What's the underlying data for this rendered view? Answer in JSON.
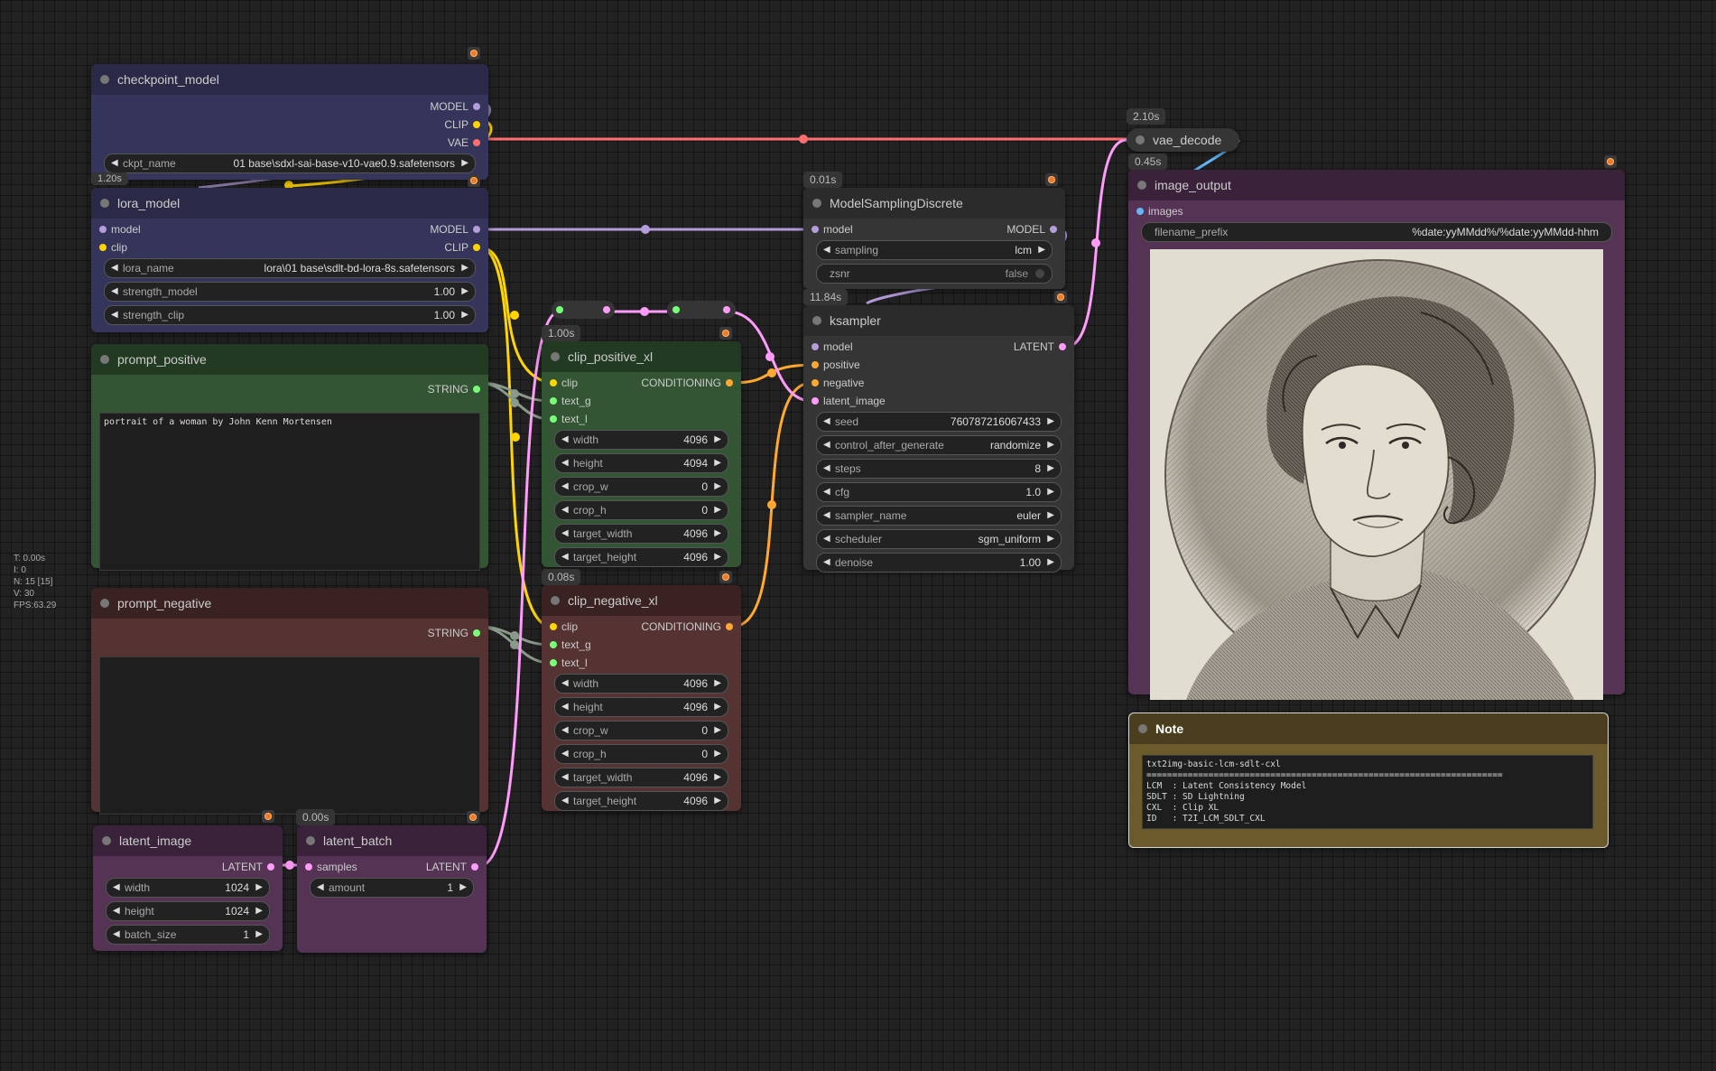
{
  "colors": {
    "model": "#b39ddb",
    "clip": "#ffd500",
    "vae": "#ff6e6e",
    "conditioning": "#ffa931",
    "latent": "#ff9cf9",
    "string": "#77ff77",
    "image": "#64b5f6",
    "reroute": "#aaaaaa"
  },
  "stats": {
    "t": "T: 0.00s",
    "i": "I: 0",
    "n": "N: 15 [15]",
    "v": "V: 30",
    "fps": "FPS:63.29"
  },
  "checkpoint_model": {
    "title": "checkpoint_model",
    "timer": "1.20s",
    "outputs": [
      "MODEL",
      "CLIP",
      "VAE"
    ],
    "ckpt_label": "ckpt_name",
    "ckpt_value": "01 base\\sdxl-sai-base-v10-vae0.9.safetensors"
  },
  "lora_model": {
    "title": "lora_model",
    "in_model": "model",
    "in_clip": "clip",
    "out_model": "MODEL",
    "out_clip": "CLIP",
    "widgets": [
      {
        "label": "lora_name",
        "value": "lora\\01 base\\sdlt-bd-lora-8s.safetensors"
      },
      {
        "label": "strength_model",
        "value": "1.00"
      },
      {
        "label": "strength_clip",
        "value": "1.00"
      }
    ]
  },
  "prompt_positive": {
    "title": "prompt_positive",
    "output": "STRING",
    "text": "portrait of a woman by John Kenn Mortensen"
  },
  "prompt_negative": {
    "title": "prompt_negative",
    "output": "STRING",
    "text": ""
  },
  "clip_positive_xl": {
    "title": "clip_positive_xl",
    "timer": "1.00s",
    "inputs": [
      "clip",
      "text_g",
      "text_l"
    ],
    "output": "CONDITIONING",
    "widgets": [
      {
        "label": "width",
        "value": "4096"
      },
      {
        "label": "height",
        "value": "4094"
      },
      {
        "label": "crop_w",
        "value": "0"
      },
      {
        "label": "crop_h",
        "value": "0"
      },
      {
        "label": "target_width",
        "value": "4096"
      },
      {
        "label": "target_height",
        "value": "4096"
      }
    ]
  },
  "clip_negative_xl": {
    "title": "clip_negative_xl",
    "timer": "0.08s",
    "inputs": [
      "clip",
      "text_g",
      "text_l"
    ],
    "output": "CONDITIONING",
    "widgets": [
      {
        "label": "width",
        "value": "4096"
      },
      {
        "label": "height",
        "value": "4096"
      },
      {
        "label": "crop_w",
        "value": "0"
      },
      {
        "label": "crop_h",
        "value": "0"
      },
      {
        "label": "target_width",
        "value": "4096"
      },
      {
        "label": "target_height",
        "value": "4096"
      }
    ]
  },
  "model_sampling": {
    "title": "ModelSamplingDiscrete",
    "timer": "0.01s",
    "input": "model",
    "output": "MODEL",
    "sampling_label": "sampling",
    "sampling_value": "lcm",
    "zsnr_label": "zsnr",
    "zsnr_value": "false"
  },
  "ksampler": {
    "title": "ksampler",
    "timer": "11.84s",
    "inputs": [
      "model",
      "positive",
      "negative",
      "latent_image"
    ],
    "output": "LATENT",
    "widgets": [
      {
        "label": "seed",
        "value": "760787216067433"
      },
      {
        "label": "control_after_generate",
        "value": "randomize"
      },
      {
        "label": "steps",
        "value": "8"
      },
      {
        "label": "cfg",
        "value": "1.0"
      },
      {
        "label": "sampler_name",
        "value": "euler"
      },
      {
        "label": "scheduler",
        "value": "sgm_uniform"
      },
      {
        "label": "denoise",
        "value": "1.00"
      }
    ]
  },
  "vae_decode": {
    "title": "vae_decode",
    "timer": "2.10s"
  },
  "image_output": {
    "title": "image_output",
    "timer": "0.45s",
    "input": "images",
    "prefix_label": "filename_prefix",
    "prefix_value": "%date:yyMMdd%/%date:yyMMdd-hhm"
  },
  "note": {
    "title": "Note",
    "text": "txt2img-basic-lcm-sdlt-cxl\n=====================================================================\nLCM  : Latent Consistency Model\nSDLT : SD Lightning\nCXL  : Clip XL\nID   : T2I_LCM_SDLT_CXL"
  },
  "latent_image": {
    "title": "latent_image",
    "output": "LATENT",
    "widgets": [
      {
        "label": "width",
        "value": "1024"
      },
      {
        "label": "height",
        "value": "1024"
      },
      {
        "label": "batch_size",
        "value": "1"
      }
    ]
  },
  "latent_batch": {
    "title": "latent_batch",
    "timer": "0.00s",
    "input": "samples",
    "output": "LATENT",
    "amount_label": "amount",
    "amount_value": "1"
  }
}
